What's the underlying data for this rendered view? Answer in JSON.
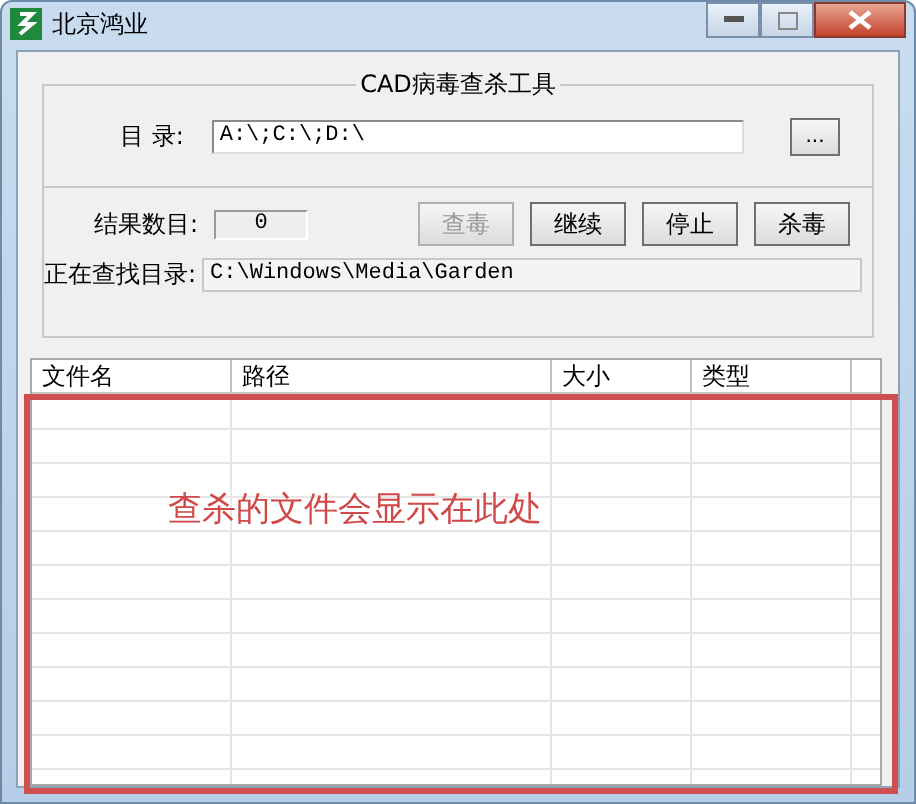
{
  "window": {
    "title": "北京鸿业"
  },
  "group": {
    "title": "CAD病毒查杀工具"
  },
  "directory": {
    "label": "目 录:",
    "value": "A:\\;C:\\;D:\\",
    "browse": "..."
  },
  "result_count": {
    "label": "结果数目:",
    "value": "0"
  },
  "buttons": [
    {
      "label": "查毒",
      "disabled": true
    },
    {
      "label": "继续",
      "disabled": false
    },
    {
      "label": "停止",
      "disabled": false
    },
    {
      "label": "杀毒",
      "disabled": false
    }
  ],
  "current_dir": {
    "label": "正在查找目录:",
    "value": "C:\\Windows\\Media\\Garden"
  },
  "table": {
    "columns": [
      "文件名",
      "路径",
      "大小",
      "类型"
    ]
  },
  "annotation": "查杀的文件会显示在此处"
}
